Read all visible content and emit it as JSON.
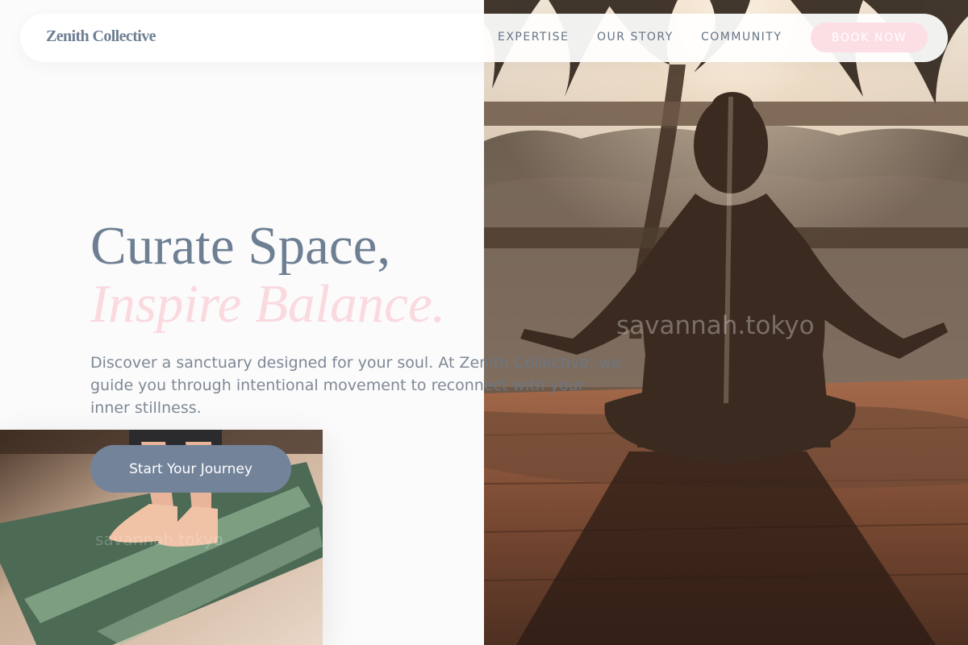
{
  "nav": {
    "logo": "Zenith Collective",
    "links": [
      "EXPERTISE",
      "OUR STORY",
      "COMMUNITY"
    ],
    "book_label": "BOOK NOW"
  },
  "hero": {
    "headline_line1": "Curate Space,",
    "headline_line2": "Inspire Balance.",
    "intro": "Discover a sanctuary designed for your soul. At Zenith Collective, we guide you through intentional movement to reconnect with your inner stillness.",
    "cta_label": "Start Your Journey"
  },
  "watermarks": {
    "hero": "savannah.tokyo",
    "mat": "savannah.tokyo"
  },
  "colors": {
    "slate": "#6e7f93",
    "blush": "#fad9df",
    "cta": "#72839a",
    "book_bg": "#fcdfe4"
  },
  "images": {
    "hero": "woman-meditating-lotus-pose-sunset-photo",
    "mat": "bare-feet-on-green-yoga-mat-photo"
  }
}
